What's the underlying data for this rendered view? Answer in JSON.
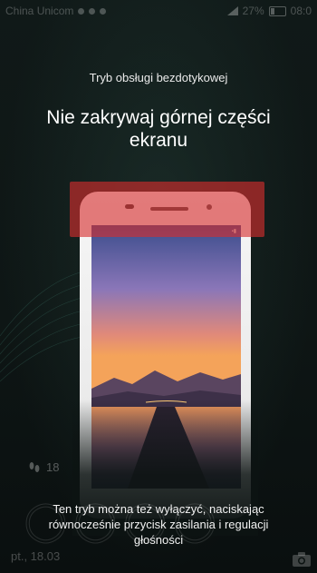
{
  "status_bar": {
    "carrier": "China Unicom",
    "battery": "27%",
    "time": "08:0"
  },
  "instructions": {
    "subtitle": "Tryb obsługi bezdotykowej",
    "title": "Nie zakrywaj górnej części ekranu",
    "footer": "Ten tryb można też wyłączyć, naciskając równocześnie przycisk zasilania i regulacji głośności"
  },
  "lockscreen": {
    "steps": "18",
    "date": "pt., 18.03"
  },
  "colors": {
    "highlight": "#d62d2d",
    "background": "#0c1312"
  },
  "icons": [
    "signal-icon",
    "battery-icon",
    "footprints-icon",
    "camera-icon"
  ]
}
